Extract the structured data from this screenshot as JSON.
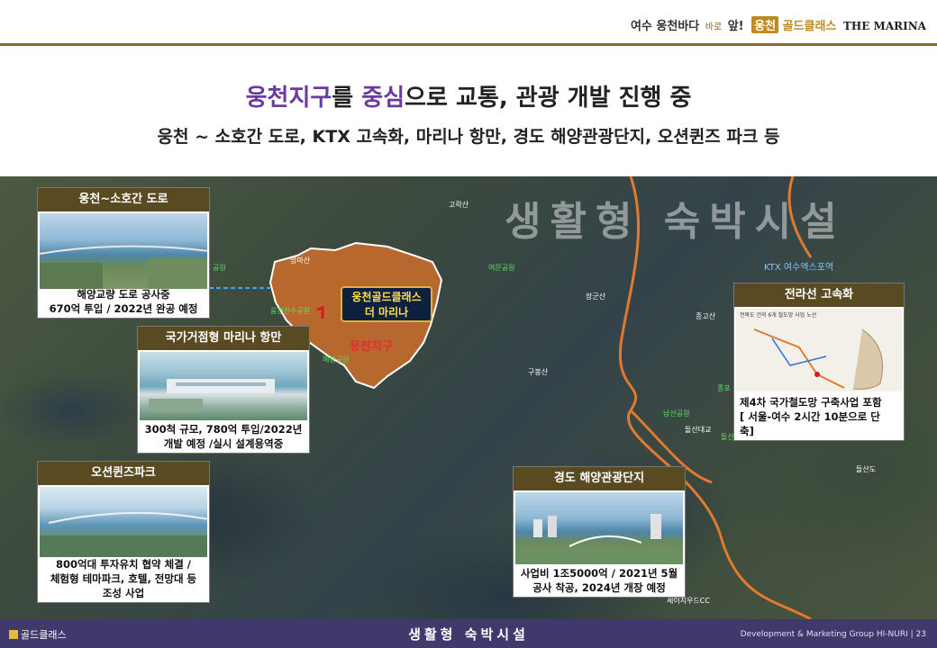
{
  "brand": {
    "text1": "여수 웅천바다",
    "small": "바로",
    "text2": "앞!",
    "tag": "웅천",
    "gold": "골드클래스",
    "marina": "THE MARINA"
  },
  "headline": {
    "part1": "웅천지구",
    "part2": "를 ",
    "part3": "중심",
    "part4": "으로 교통, 관광 개발 진행 중"
  },
  "subline": "웅천 ~ 소호간 도로, KTX 고속화, 마리나 항만, 경도 해양관광단지, 오션퀸즈 파크 등",
  "map": {
    "watermark": "생활형 숙박시설",
    "places": [
      {
        "name": "고락산",
        "cls": ""
      },
      {
        "name": "망마산",
        "cls": ""
      },
      {
        "name": "여문공원",
        "cls": "g"
      },
      {
        "name": "장군산",
        "cls": ""
      },
      {
        "name": "종고산",
        "cls": ""
      },
      {
        "name": "구봉산",
        "cls": ""
      },
      {
        "name": "남산공원",
        "cls": "g"
      },
      {
        "name": "돌산대교",
        "cls": ""
      },
      {
        "name": "돌산도",
        "cls": ""
      },
      {
        "name": "웅천친수공원",
        "cls": "g"
      },
      {
        "name": "해봉공원",
        "cls": "g"
      },
      {
        "name": "KTX 여수엑스포역",
        "cls": "b"
      },
      {
        "name": "세이지우드CC",
        "cls": ""
      },
      {
        "name": "공원",
        "cls": "g"
      },
      {
        "name": "종포",
        "cls": "g"
      },
      {
        "name": "돌산",
        "cls": "g"
      }
    ],
    "zone_label_line1": "웅천골드클래스",
    "zone_label_line2": "더 마리나",
    "zone_text": "웅천지구"
  },
  "cards": {
    "road": {
      "title": "웅천~소호간 도로",
      "caption": "해양교량 도로 공사중\n670억 투입 / 2022년 완공 예정"
    },
    "marina": {
      "title": "국가거점형 마리나 항만",
      "caption": "300척 규모, 780억 투입/2022년\n개발 예정 /실시 설계용역중"
    },
    "ocean": {
      "title": "오션퀸즈파크",
      "caption": "800억대 투자유치 협약 체결 /\n체험형 테마파크, 호텔, 전망대 등\n조성 사업"
    },
    "ktx": {
      "title": "전라선 고속화",
      "chart_heading": "전북도 건의 6개 철도망 사업 노선",
      "caption": "제4차 국가철도망 구축사업 포함\n[ 서울-여수 2시간 10분으로 단\n축]"
    },
    "gyeongdo": {
      "title": "경도 해양관광단지",
      "caption": "사업비 1조5000억 / 2021년 5월\n공사 착공, 2024년 개장 예정"
    }
  },
  "footer": {
    "logo": "골드클래스",
    "center": "생활형 숙박시설",
    "right": "Development & Marketing Group HI-NURI | 23"
  },
  "colors": {
    "accent_purple": "#6b3aa0",
    "footer_bg": "#3f3a6b",
    "card_title_bg": "#5a4a22",
    "gold": "#c08a1e"
  }
}
